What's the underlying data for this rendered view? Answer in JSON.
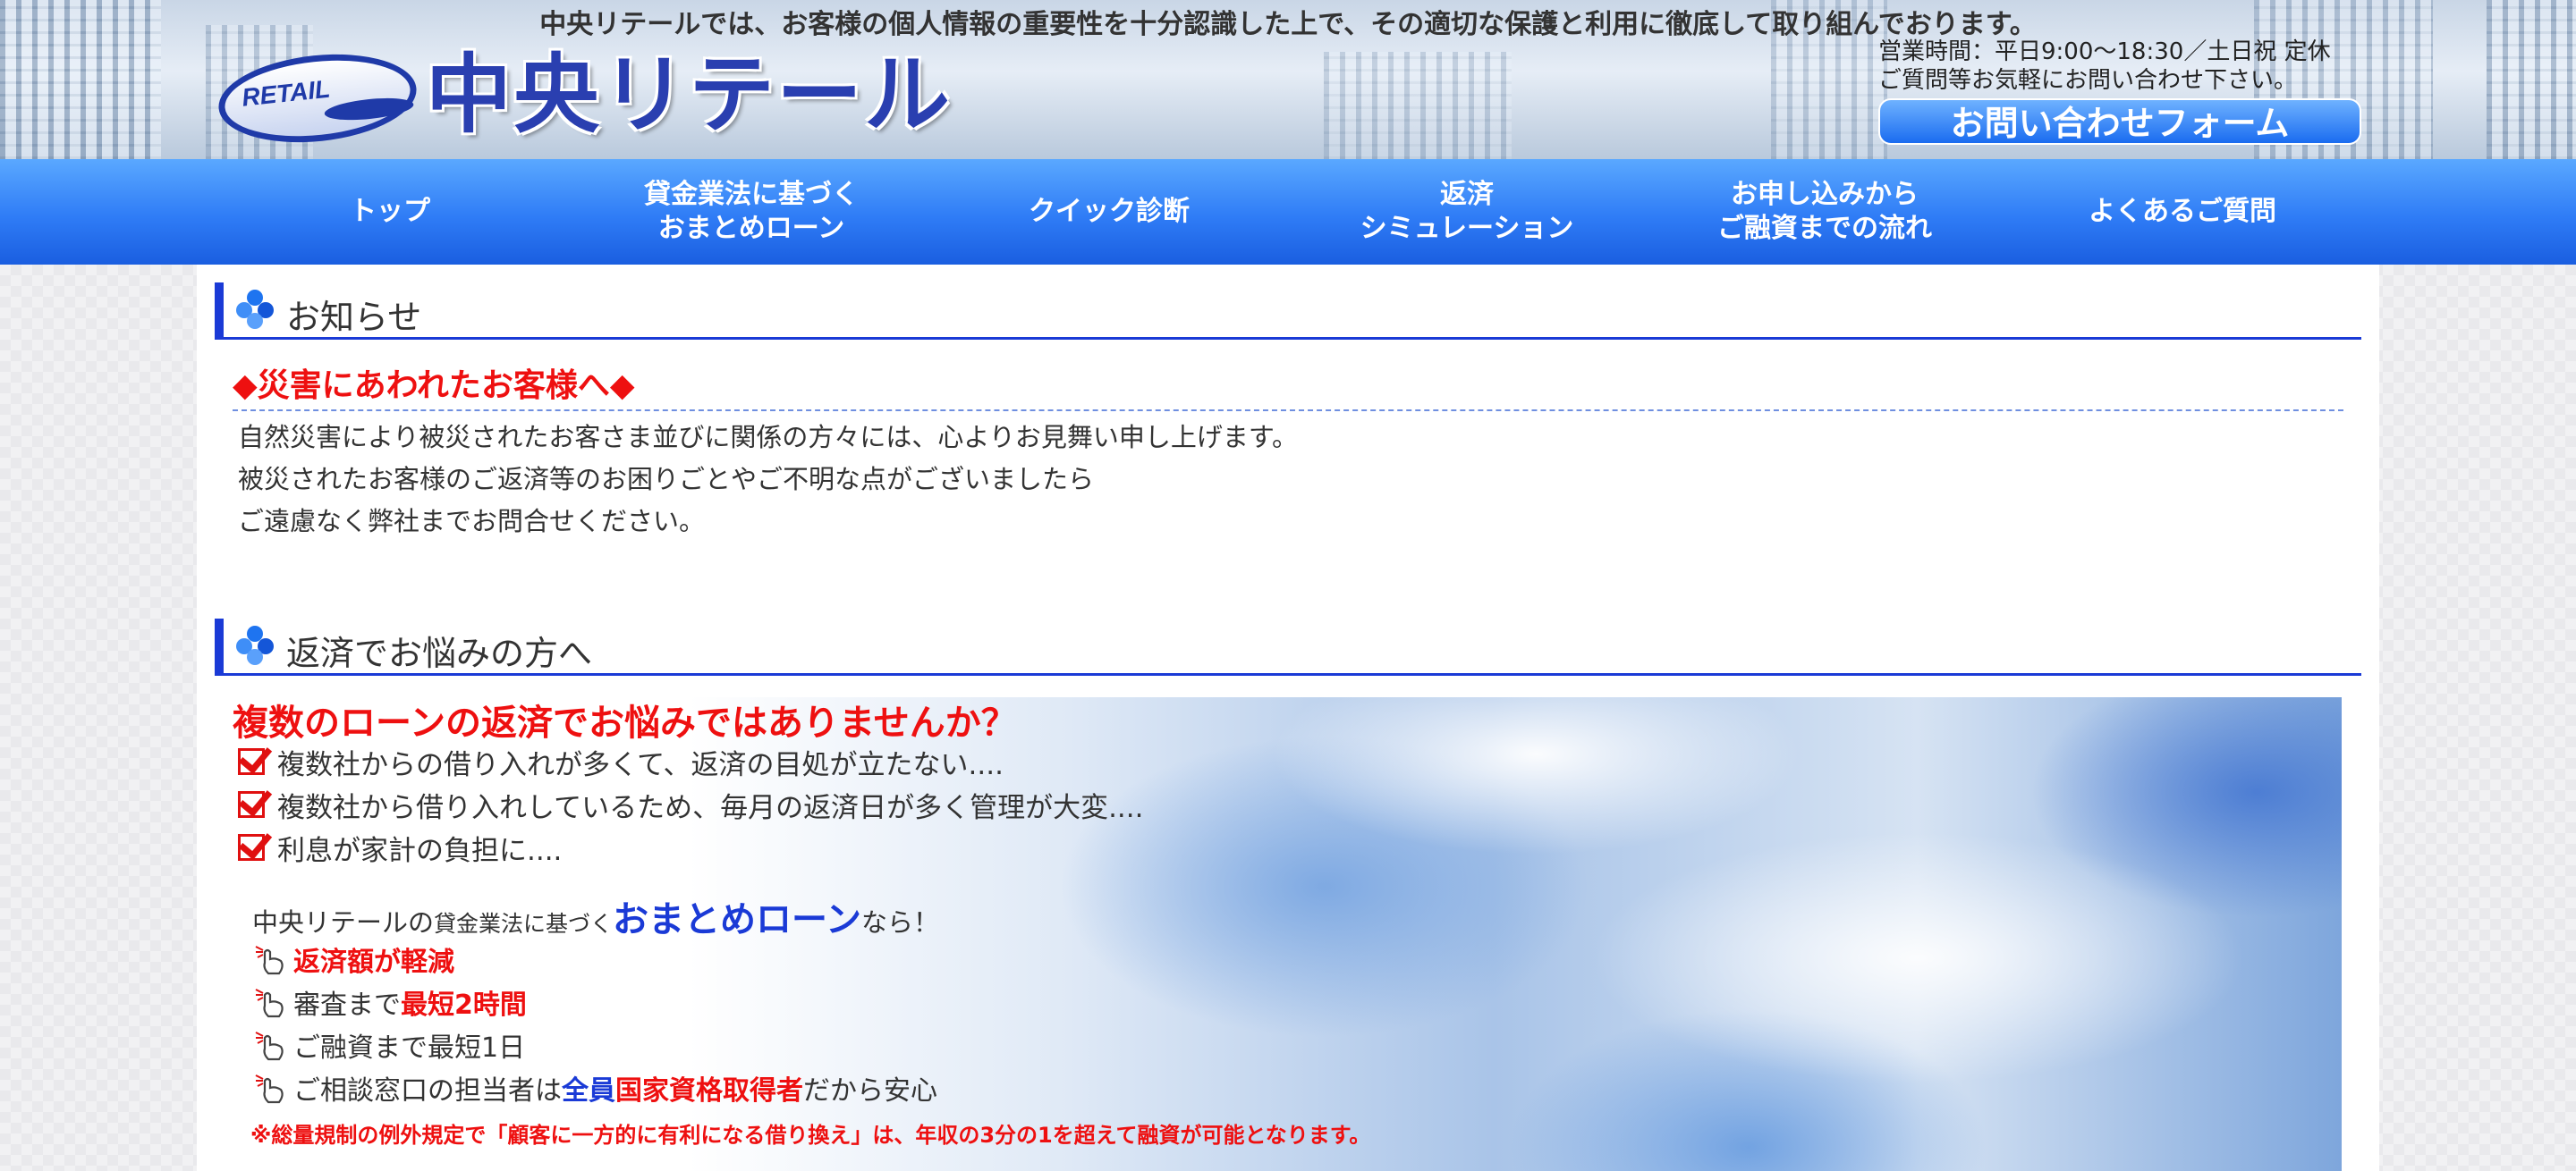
{
  "header": {
    "privacy_notice": "中央リテールでは、お客様の個人情報の重要性を十分認識した上で、その適切な保護と利用に徹底して取り組んでおります。",
    "logo_badge_text": "RETAIL",
    "logo_name": "中央リテール",
    "hours_line1": "営業時間：平日9:00〜18:30／土日祝 定休",
    "hours_line2": "ご質問等お気軽にお問い合わせ下さい。",
    "contact_button": "お問い合わせフォーム"
  },
  "nav": {
    "items": [
      {
        "label": "トップ"
      },
      {
        "label": "貸金業法に基づく\nおまとめローン"
      },
      {
        "label": "クイック診断"
      },
      {
        "label": "返済\nシミュレーション"
      },
      {
        "label": "お申し込みから\nご融資までの流れ"
      },
      {
        "label": "よくあるご質問"
      }
    ]
  },
  "news": {
    "heading": "お知らせ",
    "notice_title": "◆災害にあわれたお客様へ◆",
    "body": [
      "自然災害により被災されたお客さま並びに関係の方々には、心よりお見舞い申し上げます。",
      "被災されたお客様のご返済等のお困りごとやご不明な点がございましたら",
      "ご遠慮なく弊社までお問合せください。"
    ]
  },
  "repay": {
    "heading": "返済でお悩みの方へ",
    "question": "複数のローンの返済でお悩みではありませんか？",
    "checks": [
      "複数社からの借り入れが多くて、返済の目処が立たない....",
      "複数社から借り入れしているため、毎月の返済日が多く管理が大変....",
      "利息が家計の負担に...."
    ],
    "lead_pre": "中央リテールの",
    "lead_small": "貸金業法に基づく",
    "lead_big": "おまとめローン",
    "lead_post": "なら！",
    "features": [
      {
        "a": "",
        "b": "返済額が軽減",
        "c": "",
        "d": "",
        "e": ""
      },
      {
        "a": "審査まで",
        "b": "最短2時間",
        "c": "",
        "d": "",
        "e": ""
      },
      {
        "a": "ご融資まで最短1日",
        "b": "",
        "c": "",
        "d": "",
        "e": ""
      },
      {
        "a": "ご相談窓口の担当者は",
        "b": "",
        "c": "全員",
        "d": "国家資格取得者",
        "e": "だから安心"
      }
    ],
    "footnote": "※総量規制の例外規定で「顧客に一方的に有利になる借り換え」は、年収の3分の1を超えて融資が可能となります。"
  },
  "colors": {
    "nav_blue": "#2f7cf6",
    "accent_red": "#ee1010",
    "heading_blue": "#1a3ad6"
  },
  "icons": [
    "checkbox-checked-icon",
    "pointing-hand-icon",
    "blue-dots-icon"
  ]
}
